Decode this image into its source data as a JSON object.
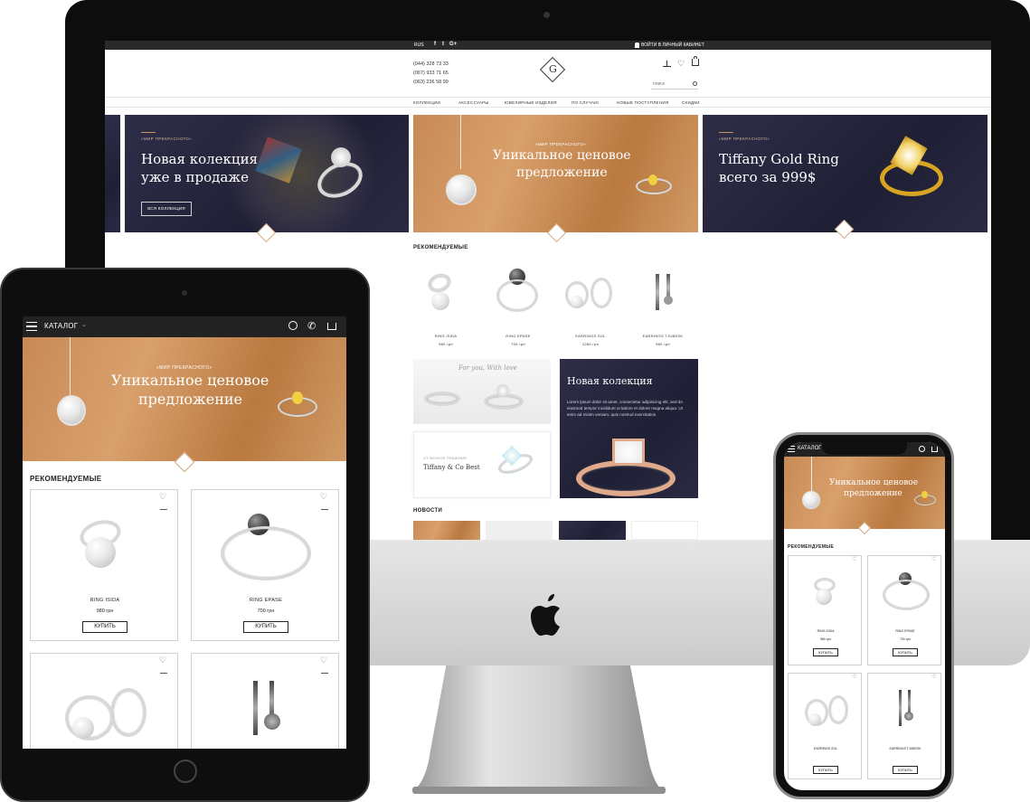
{
  "desktop": {
    "topbar": {
      "lang": "RUS",
      "social": [
        "f",
        "t",
        "G+"
      ],
      "login": "ВОЙТИ В ЛИЧНЫЙ КАБИНЕТ"
    },
    "phones": [
      "(044) 328 73 33",
      "(067) 933 71 65",
      "(063) 236 58 99"
    ],
    "search_placeholder": "поиск",
    "nav": [
      "КОЛЛЕКЦИИ",
      "АКСЕССУАРЫ",
      "ЮВЕЛИРНЫЕ ИЗДЕЛИЯ",
      "ПО СЛУЧАЮ",
      "НОВЫЕ ПОСТУПЛЕНИЯ",
      "СКИДКИ"
    ],
    "banners": [
      {
        "tag": "«МИР ПРЕКРАСНОГО»",
        "title_line1": "Новая колекция",
        "title_line2": "уже в продаже",
        "button": "ВСЯ КОЛЛЕКЦИЯ"
      },
      {
        "tag": "«МИР ПРЕКРАСНОГО»",
        "title_line1": "Уникальное ценовое",
        "title_line2": "предложение"
      },
      {
        "tag": "«МИР ПРЕКРАСНОГО»",
        "title_line1": "Tiffany Gold Ring",
        "title_line2": "всего за 999$"
      }
    ],
    "recommended_title": "РЕКОМЕНДУЕМЫЕ",
    "products": [
      {
        "name": "RING ISIDA",
        "price": "980 грн"
      },
      {
        "name": "RING EPASE",
        "price": "700 грн"
      },
      {
        "name": "EARRINGS SOL",
        "price": "1280 грн"
      },
      {
        "name": "EARRINGS TJUBESK",
        "price": "980 грн"
      }
    ],
    "promo_script": "For you, With love",
    "promo_small_tag": "ОТЛИЧНОЕ РЕШЕНИЕ",
    "promo_small_title": "Tiffany & Co Best",
    "new_collection": {
      "title": "Новая колекция",
      "text": "Lorem ipsum dolor sit amet, consectetur adipisicing elit, sed do eiusmod tempor incididunt ut labore et dolore magna aliqua. Ut enim ad minim veniam, quis nostrud exercitation"
    },
    "news_title": "НОВОСТИ"
  },
  "tablet": {
    "menu_label": "КАТАЛОГ",
    "banner_tag": "«МИР ПРЕКРАСНОГО»",
    "banner_line1": "Уникальное ценовое",
    "banner_line2": "предложение",
    "recommended_title": "РЕКОМЕНДУЕМЫЕ",
    "products": [
      {
        "name": "RING ISIDA",
        "price": "980 грн",
        "button": "КУПИТЬ"
      },
      {
        "name": "RING EPASE",
        "price": "700 грн",
        "button": "КУПИТЬ"
      }
    ]
  },
  "phone": {
    "menu_label": "КАТАЛОГ",
    "banner_line1": "Уникальное ценовое",
    "banner_line2": "предложение",
    "recommended_title": "РЕКОМЕНДУЕМЫЕ",
    "products": [
      {
        "name": "RING ISIDA",
        "price": "980 грн",
        "button": "КУПИТЬ"
      },
      {
        "name": "RING EPASE",
        "price": "700 грн",
        "button": "КУПИТЬ"
      },
      {
        "name": "EARRINGS SOL",
        "button": "КУПИТЬ"
      },
      {
        "name": "EARRINGS TJUBESK",
        "button": "КУПИТЬ"
      }
    ]
  },
  "colors": {
    "accent_gold": "#c9955e",
    "navy": "#25253d",
    "device_black": "#111111",
    "aluminum": "#d6d6d6"
  },
  "icons": [
    "apple-logo-icon",
    "hamburger-icon",
    "search-icon",
    "phone-icon",
    "cart-icon",
    "heart-icon",
    "compare-icon",
    "user-icon",
    "logo-monogram-icon"
  ]
}
